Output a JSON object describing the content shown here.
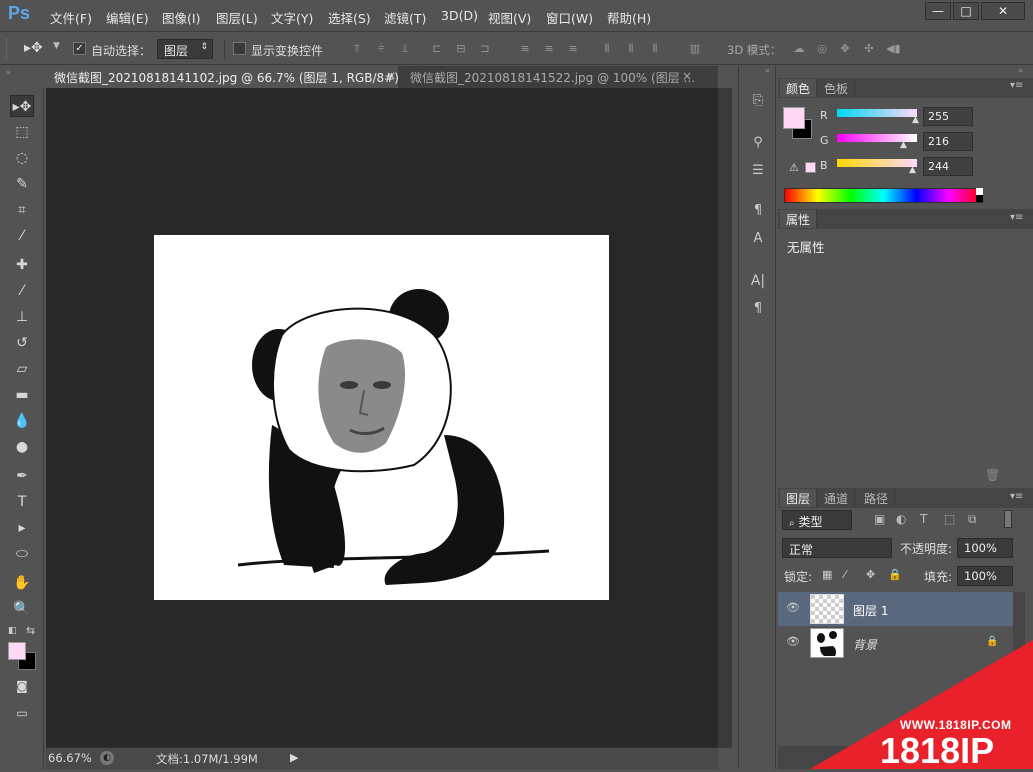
{
  "app": {
    "logo": "Ps"
  },
  "menu": [
    "文件(F)",
    "编辑(E)",
    "图像(I)",
    "图层(L)",
    "文字(Y)",
    "选择(S)",
    "滤镜(T)",
    "3D(D)",
    "视图(V)",
    "窗口(W)",
    "帮助(H)"
  ],
  "window_controls": {
    "minimize": "—",
    "restore": "□",
    "close": "✕"
  },
  "options": {
    "auto_select_label": "自动选择：",
    "auto_select_value": "图层",
    "show_transform_label": "显示变换控件",
    "mode_3d_label": "3D 模式："
  },
  "tabs": [
    {
      "title": "微信截图_20210818141102.jpg @ 66.7% (图层 1, RGB/8#) *",
      "close": "×"
    },
    {
      "title": "微信截图_20210818141522.jpg @ 100% (图层 ...",
      "close": "×"
    }
  ],
  "status": {
    "zoom": "66.67%",
    "doc_size": "文档:1.07M/1.99M"
  },
  "color_panel": {
    "tabs": [
      "颜色",
      "色板"
    ],
    "channels": [
      {
        "label": "R",
        "value": "255"
      },
      {
        "label": "G",
        "value": "216"
      },
      {
        "label": "B",
        "value": "244"
      }
    ],
    "foreground": "#ffd8f4",
    "background": "#000000"
  },
  "properties_panel": {
    "tab": "属性",
    "text": "无属性"
  },
  "layers_panel": {
    "tabs": [
      "图层",
      "通道",
      "路径"
    ],
    "filter_label": "类型",
    "blend_mode": "正常",
    "opacity_label": "不透明度:",
    "opacity_value": "100%",
    "lock_label": "锁定:",
    "fill_label": "填充:",
    "fill_value": "100%",
    "layers": [
      {
        "name": "图层 1",
        "selected": true
      },
      {
        "name": "背景",
        "selected": false
      }
    ]
  },
  "watermark": {
    "url": "WWW.1818IP.COM",
    "brand": "1818IP"
  }
}
